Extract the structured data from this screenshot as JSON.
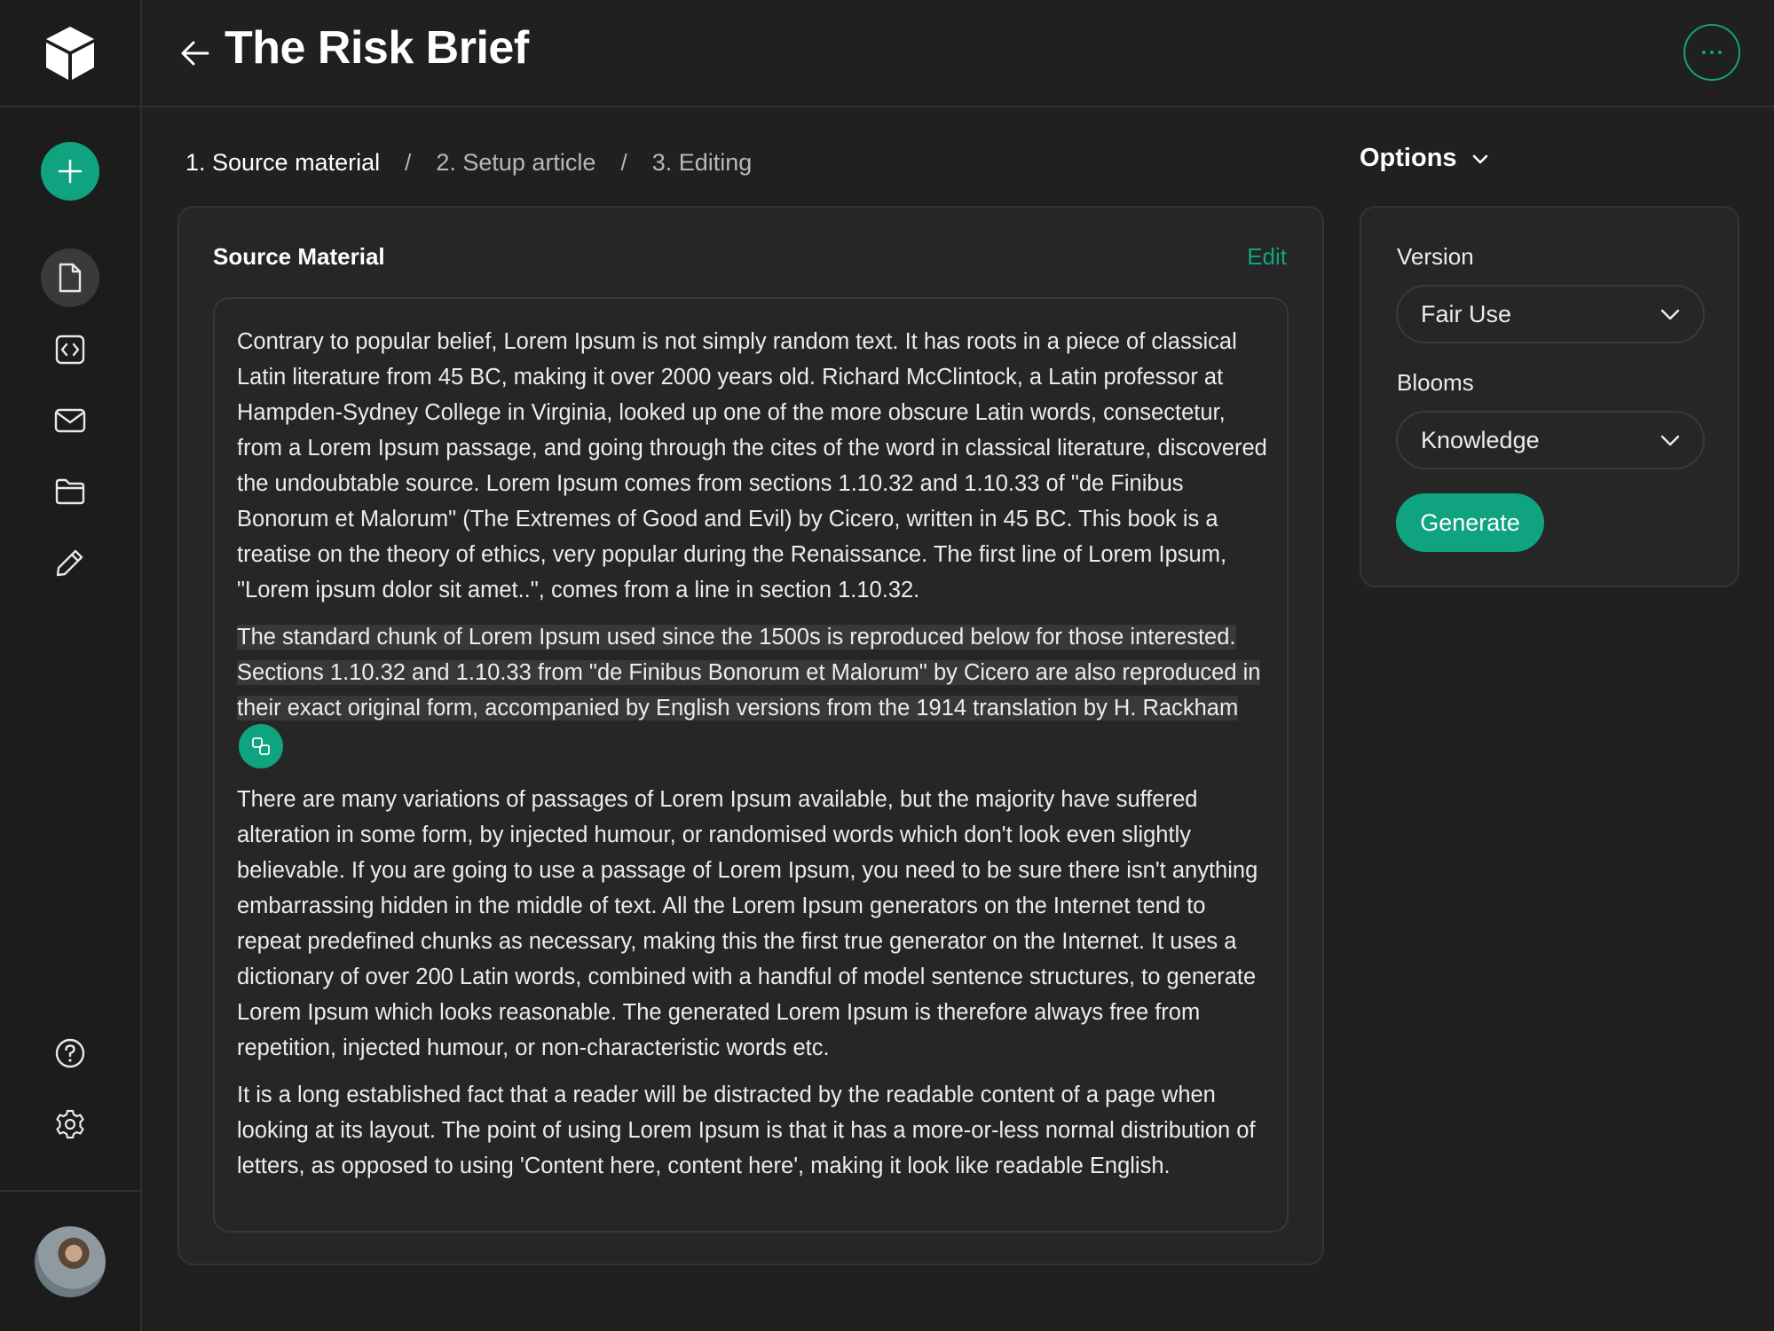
{
  "header": {
    "title": "The Risk Brief"
  },
  "sidebar": {
    "items": [
      {
        "icon": "plus-icon",
        "active": false
      },
      {
        "icon": "document-icon",
        "active": true
      },
      {
        "icon": "code-icon"
      },
      {
        "icon": "mail-icon"
      },
      {
        "icon": "folder-icon"
      },
      {
        "icon": "pencil-icon"
      },
      {
        "icon": "help-icon"
      },
      {
        "icon": "gear-icon"
      }
    ]
  },
  "steps": [
    {
      "label": "1. Source material",
      "active": true
    },
    {
      "label": "2. Setup article",
      "active": false
    },
    {
      "label": "3. Editing",
      "active": false
    }
  ],
  "step_separator": "/",
  "source": {
    "title": "Source Material",
    "edit_label": "Edit",
    "paragraphs": [
      "Contrary to popular belief, Lorem Ipsum is not simply random text. It has roots in a piece of classical Latin literature from 45 BC, making it over 2000 years old. Richard McClintock, a Latin professor at Hampden-Sydney College in Virginia, looked up one of the more obscure Latin words, consectetur, from a Lorem Ipsum passage, and going through the cites of the word in classical literature, discovered the undoubtable source. Lorem Ipsum comes from sections 1.10.32 and 1.10.33 of \"de Finibus Bonorum et Malorum\" (The Extremes of Good and Evil) by Cicero, written in 45 BC. This book is a treatise on the theory of ethics, very popular during the Renaissance. The first line of Lorem Ipsum, \"Lorem ipsum dolor sit amet..\", comes from a line in section 1.10.32.",
      "The standard chunk of Lorem Ipsum used since the 1500s is reproduced below for those interested. Sections 1.10.32 and 1.10.33 from \"de Finibus Bonorum et Malorum\" by Cicero are also reproduced in their exact original form, accompanied by English versions from the 1914 translation by H. Rackham",
      "There are many variations of passages of Lorem Ipsum available, but the majority have suffered alteration in some form, by injected humour, or randomised words which don't look even slightly believable. If you are going to use a passage of Lorem Ipsum, you need to be sure there isn't anything embarrassing hidden in the middle of text. All the Lorem Ipsum generators on the Internet tend to repeat predefined chunks as necessary, making this the first true generator on the Internet. It uses a dictionary of over 200 Latin words, combined with a handful of model sentence structures, to generate Lorem Ipsum which looks reasonable. The generated Lorem Ipsum is therefore always free from repetition, injected humour, or non-characteristic words etc.",
      "It is a long established fact that a reader will be distracted by the readable content of a page when looking at its layout. The point of using Lorem Ipsum is that it has a more-or-less normal distribution of letters, as opposed to using 'Content here, content here', making it look like readable English."
    ],
    "highlighted_paragraph": 1
  },
  "options": {
    "title": "Options",
    "version_label": "Version",
    "version_value": "Fair Use",
    "blooms_label": "Blooms",
    "blooms_value": "Knowledge",
    "generate_label": "Generate"
  },
  "colors": {
    "accent": "#10a37f",
    "background": "#202020",
    "panel": "#262626"
  }
}
